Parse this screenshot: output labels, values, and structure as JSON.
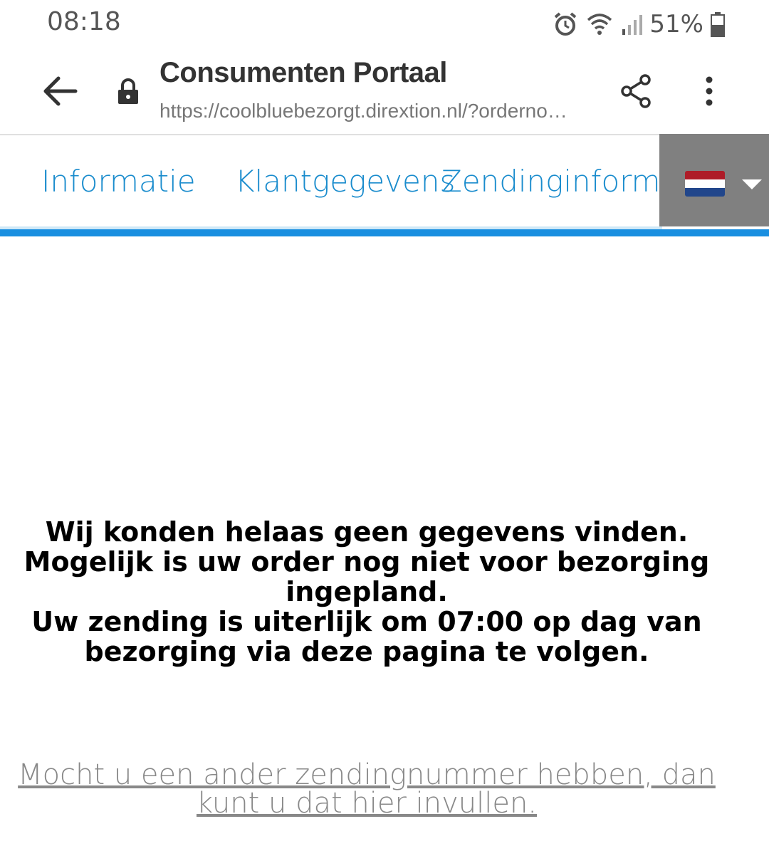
{
  "status_bar": {
    "time": "08:18",
    "battery": "51%",
    "icons": [
      "alarm-icon",
      "wifi-icon",
      "signal-icon",
      "battery-icon"
    ]
  },
  "toolbar": {
    "title": "Consumenten Portaal",
    "url": "https://coolbluebezorgt.dirextion.nl/?orderno…",
    "icons": [
      "back-arrow-icon",
      "lock-icon",
      "share-icon",
      "more-vert-icon"
    ]
  },
  "nav": {
    "tabs": [
      {
        "label": "Informatie"
      },
      {
        "label": "Klantgegevens"
      },
      {
        "label": "Zendinginformatie"
      }
    ],
    "language": {
      "flag": "netherlands-flag-icon",
      "flag_colors": [
        "#ae1c28",
        "#ffffff",
        "#21468b"
      ]
    },
    "accent": "#1a8fe0"
  },
  "message": {
    "line1": "Wij konden helaas geen gegevens vinden.",
    "line2": "Mogelijk is uw order nog niet voor bezorging ingepland.",
    "line3": "Uw zending is uiterlijk om 07:00 op dag van bezorging via deze pagina te volgen."
  },
  "footer_link": "Mocht u een ander zendingnummer hebben, dan kunt u dat hier invullen."
}
